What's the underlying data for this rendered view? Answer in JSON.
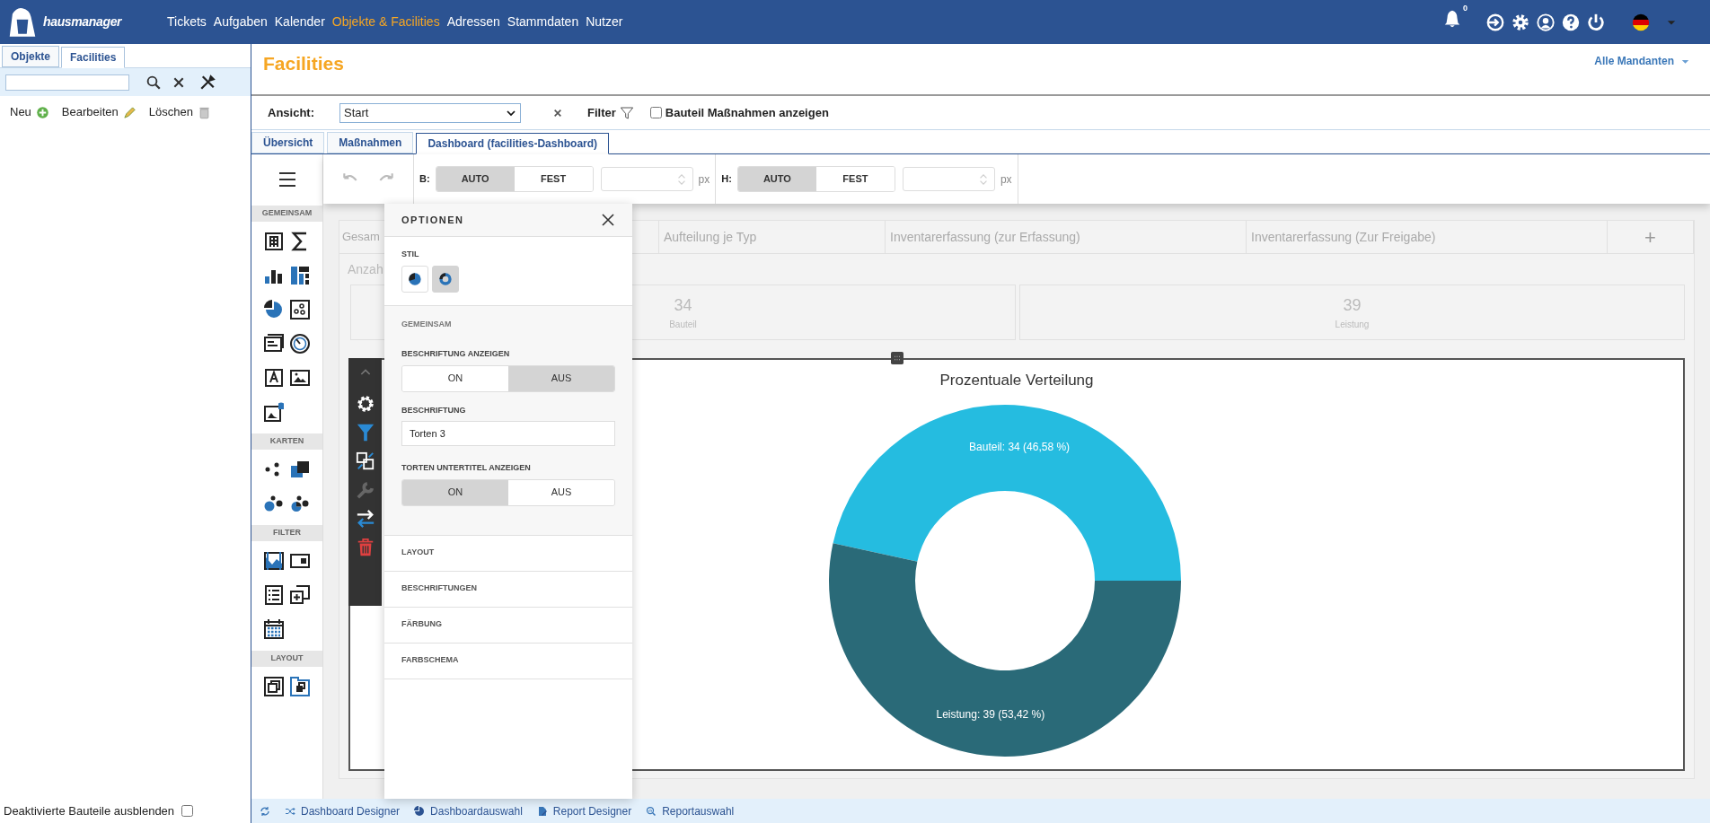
{
  "header": {
    "logo_text": "hausmanager",
    "nav": [
      {
        "label": "Tickets",
        "selected": false
      },
      {
        "label": "Aufgaben",
        "selected": false
      },
      {
        "label": "Kalender",
        "selected": false
      },
      {
        "label": "Objekte & Facilities",
        "selected": true
      },
      {
        "label": "Adressen",
        "selected": false
      },
      {
        "label": "Stammdaten",
        "selected": false
      },
      {
        "label": "Nutzer",
        "selected": false
      }
    ],
    "notification_count": "0"
  },
  "left_panel": {
    "tabs": [
      {
        "label": "Objekte",
        "selected": false
      },
      {
        "label": "Facilities",
        "selected": true
      }
    ],
    "actions": [
      "Neu",
      "Bearbeiten",
      "Löschen"
    ],
    "footer_checkbox": {
      "label": "Deaktivierte Bauteile ausblenden",
      "checked": false
    }
  },
  "main": {
    "title": "Facilities",
    "mandant": "Alle Mandanten",
    "view": {
      "label": "Ansicht:",
      "value": "Start"
    },
    "filter_label": "Filter",
    "measures_checkbox": {
      "label": "Bauteil Maßnahmen anzeigen",
      "checked": false
    },
    "tabs": [
      {
        "label": "Übersicht",
        "selected": false
      },
      {
        "label": "Maßnahmen",
        "selected": false
      },
      {
        "label": "Dashboard (facilities-Dashboard)",
        "selected": true
      }
    ]
  },
  "designer": {
    "toolbar": {
      "sizes": [
        {
          "label": "B:",
          "options": [
            {
              "label": "AUTO",
              "selected": true
            },
            {
              "label": "FEST",
              "selected": false
            }
          ],
          "unit": "px"
        },
        {
          "label": "H:",
          "options": [
            {
              "label": "AUTO",
              "selected": true
            },
            {
              "label": "FEST",
              "selected": false
            }
          ],
          "unit": "px"
        }
      ]
    },
    "palette": [
      {
        "title": "GEMEINSAM"
      },
      {
        "title": "KARTEN"
      },
      {
        "title": "FILTER"
      },
      {
        "title": "LAYOUT"
      }
    ],
    "dashboard": {
      "tabs": [
        "Gesam",
        "Aufteilung je Typ",
        "Inventarerfassung (zur Erfassung)",
        "Inventarerfassung (Zur Freigabe)",
        "+"
      ],
      "group_label": "Anzah",
      "stats": [
        {
          "value": "34",
          "label": "Bauteil"
        },
        {
          "value": "39",
          "label": "Leistung"
        }
      ],
      "chart": {
        "chart_data": {
          "type": "donut",
          "title": "Prozentuale Verteilung",
          "values": [
            34,
            39
          ],
          "colors": [
            "#25bce0",
            "#2a6a78"
          ],
          "value_labels": [
            "Bauteil: 34 (46,58 %)",
            "Leistung: 39 (53,42 %)"
          ]
        }
      }
    },
    "options": {
      "title": "OPTIONEN",
      "style": {
        "label": "STIL",
        "options": [
          {
            "kind": "pie",
            "selected": false
          },
          {
            "kind": "donut",
            "selected": true
          }
        ]
      },
      "section": "GEMEINSAM",
      "fields": [
        {
          "kind": "toggle",
          "label": "BESCHRIFTUNG ANZEIGEN",
          "options": [
            {
              "label": "ON",
              "selected": false
            },
            {
              "label": "AUS",
              "selected": true
            }
          ]
        },
        {
          "kind": "text",
          "label": "BESCHRIFTUNG",
          "value": "Torten 3"
        },
        {
          "kind": "toggle",
          "label": "TORTEN UNTERTITEL ANZEIGEN",
          "options": [
            {
              "label": "ON",
              "selected": true
            },
            {
              "label": "AUS",
              "selected": false
            }
          ]
        }
      ],
      "collapsed_sections": [
        "LAYOUT",
        "BESCHRIFTUNGEN",
        "FÄRBUNG",
        "FARBSCHEMA"
      ]
    }
  },
  "footer_links": [
    "Dashboard Designer",
    "Dashboardauswahl",
    "Report Designer",
    "Reportauswahl"
  ]
}
